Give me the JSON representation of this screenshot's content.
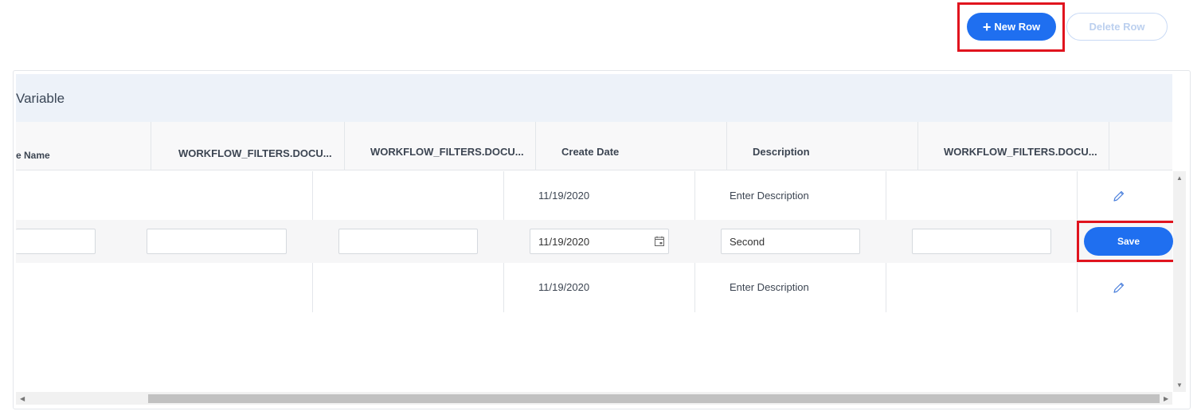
{
  "toolbar": {
    "new_row_label": "New Row",
    "new_row_icon": "+",
    "delete_row_label": "Delete Row"
  },
  "panel": {
    "title": "Variable"
  },
  "columns": [
    "e Name",
    "WORKFLOW_FILTERS.DOCU...",
    "WORKFLOW_FILTERS.DOCU...",
    "Create Date",
    "Description",
    "WORKFLOW_FILTERS.DOCU..."
  ],
  "rows": [
    {
      "create_date": "11/19/2020",
      "description": "Enter Description"
    },
    {
      "editing": true,
      "inputs": [
        "",
        "",
        "",
        "11/19/2020",
        "Second",
        ""
      ],
      "save_label": "Save"
    },
    {
      "create_date": "11/19/2020",
      "description": "Enter Description"
    }
  ],
  "colors": {
    "accent": "#1f6ff0",
    "highlight": "#e0141e",
    "header_bg": "#edf2f9"
  }
}
